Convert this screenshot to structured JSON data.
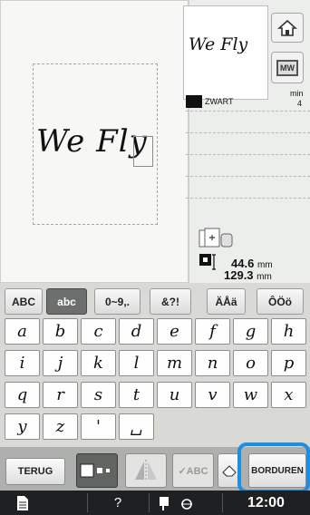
{
  "canvas": {
    "text": "We Fly"
  },
  "preview": {
    "text": "We Fly"
  },
  "buttons": {
    "home_icon": "home-icon",
    "mw_label": "MW"
  },
  "thread": {
    "color_name": "ZWART",
    "time_label": "min",
    "time_value": "4"
  },
  "size": {
    "width_value": "44.6",
    "height_value": "129.3",
    "unit": "mm"
  },
  "tabs": [
    {
      "label": "ABC",
      "active": false
    },
    {
      "label": "abc",
      "active": true
    },
    {
      "label": "0~9,.",
      "active": false
    },
    {
      "label": "&?!",
      "active": false
    },
    {
      "label": "ÄÅä",
      "active": false
    },
    {
      "label": "ÔÖö",
      "active": false
    }
  ],
  "keys": [
    [
      "a",
      "b",
      "c",
      "d",
      "e",
      "f",
      "g",
      "h"
    ],
    [
      "i",
      "j",
      "k",
      "l",
      "m",
      "n",
      "o",
      "p"
    ],
    [
      "q",
      "r",
      "s",
      "t",
      "u",
      "v",
      "w",
      "x"
    ],
    [
      "y",
      "z",
      "'",
      "␣"
    ]
  ],
  "toolbar": {
    "back_label": "TERUG",
    "spellcheck_label": "✓ABC",
    "embroider_label": "BORDUREN"
  },
  "status": {
    "time": "12:00",
    "help": "?"
  },
  "colors": {
    "highlight": "#1e8ee0",
    "status_bar": "#1f2021"
  }
}
